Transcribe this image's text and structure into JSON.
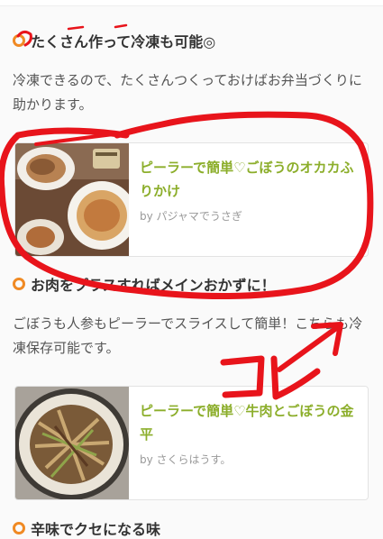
{
  "sections": [
    {
      "title": "たくさん作って冷凍も可能◎",
      "description": "冷凍できるので、たくさんつくっておけばお弁当づくりに助かります。",
      "card": {
        "title": "ピーラーで簡単♡ごぼうのオカカふりかけ",
        "author": "by パジャマでうさぎ"
      }
    },
    {
      "title": "お肉をプラスすればメインおかずに！",
      "description": "ごぼうも人参もピーラーでスライスして簡単！こちらも冷凍保存可能です。",
      "card": {
        "title": "ピーラーで簡単♡牛肉とごぼうの金平",
        "author": "by さくらはうす。"
      }
    },
    {
      "title": "辛味でクセになる味"
    }
  ],
  "annotation": {
    "handwritten_text": "コレ",
    "color": "#e8141b"
  },
  "colors": {
    "accent_orange": "#f08a24",
    "title_green": "#8cae2b",
    "marker_red": "#e8141b"
  }
}
